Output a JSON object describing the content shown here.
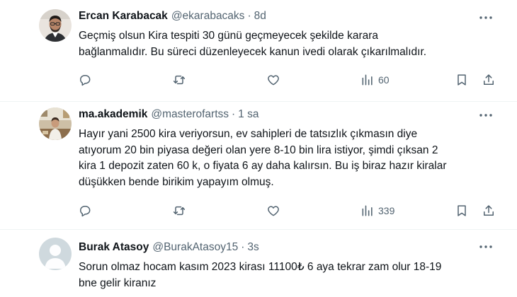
{
  "tweets": [
    {
      "name": "Ercan Karabacak",
      "handle": "@ekarabacaks",
      "sep": "·",
      "time": "8d",
      "lines": [
        "Geçmiş olsun Kira tespiti 30 günü geçmeyecek şekilde karara",
        "bağlanmalıdır.  Bu süreci düzenleyecek kanun ivedi olarak çıkarılmalıdır."
      ],
      "views": "60",
      "avatar": "photo"
    },
    {
      "name": "ma.akademik",
      "handle": "@masterofartss",
      "sep": "·",
      "time": "1 sa",
      "lines": [
        "Hayır yani 2500 kira veriyorsun, ev sahipleri de tatsızlık çıkmasın diye",
        "atıyorum 20 bin piyasa değeri olan yere 8-10 bin lira istiyor, şimdi çıksan 2",
        "kira 1 depozit zaten 60 k, o fiyata 6 ay daha kalırsın. Bu iş biraz hazır kiralar",
        "düşükken bende birikim yapayım olmuş."
      ],
      "views": "339",
      "avatar": "photo"
    },
    {
      "name": "Burak Atasoy",
      "handle": "@BurakAtasoy15",
      "sep": "·",
      "time": "3s",
      "lines": [
        "Sorun olmaz hocam kasım 2023 kirası 11100₺ 6 aya tekrar zam olur 18-19",
        "bne gelir kiranız"
      ],
      "avatar": "default-profile"
    }
  ],
  "icons": {
    "more": "more-icon",
    "reply": "reply-icon",
    "retweet": "retweet-icon",
    "like": "like-icon",
    "views": "views-icon",
    "bookmark": "bookmark-icon",
    "share": "share-icon"
  },
  "colors": {
    "text": "#0f1419",
    "muted": "#536471",
    "divider": "#eff3f4",
    "default_avatar": "#cfd9de"
  }
}
